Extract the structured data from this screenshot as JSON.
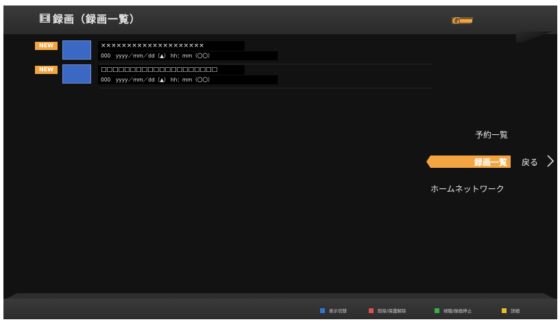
{
  "header": {
    "title": "録画（録画一覧）",
    "logo_text": "G",
    "colors": {
      "bar": "#333333",
      "logo": "#f2a540"
    }
  },
  "recordings": [
    {
      "badge": "NEW",
      "line1": "××××××××××××××××××××",
      "line2": "000　yyyy／mm／dd（▲）  hh：mm（〇〇）"
    },
    {
      "badge": "NEW",
      "line1": "□□□□□□□□□□□□□□□□□□□□",
      "line2": "000　yyyy／mm／dd（▲）  hh：mm（〇〇）"
    }
  ],
  "menu": {
    "items": [
      "予約一覧",
      "録画一覧",
      "ホームネットワーク"
    ],
    "selected_index": 1,
    "back_label": "戻る",
    "colors": {
      "selected": "#f2a540"
    }
  },
  "footer": {
    "legend": [
      {
        "color_name": "blue",
        "color": "#2f77d6",
        "label": "表示切替"
      },
      {
        "color_name": "red",
        "color": "#e05050",
        "label": "削除/保護解除"
      },
      {
        "color_name": "green",
        "color": "#3fae3f",
        "label": "視聴/録画停止"
      },
      {
        "color_name": "yellow",
        "color": "#e8c020",
        "label": "詳細"
      }
    ]
  }
}
